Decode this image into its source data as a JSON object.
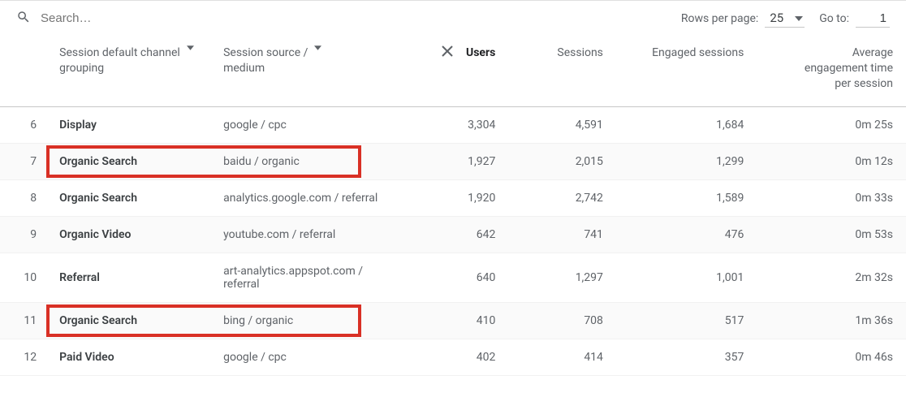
{
  "search": {
    "placeholder": "Search…"
  },
  "pager": {
    "rowsLabel": "Rows per page:",
    "rowsValue": "25",
    "gotoLabel": "Go to:",
    "gotoValue": "1"
  },
  "headers": {
    "channel": "Session default channel grouping",
    "source": "Session source / medium",
    "users": "Users",
    "sessions": "Sessions",
    "engaged": "Engaged sessions",
    "avg": "Average engagement time per session"
  },
  "rows": [
    {
      "idx": "6",
      "channel": "Display",
      "source": "google / cpc",
      "users": "3,304",
      "sessions": "4,591",
      "engaged": "1,684",
      "avg": "0m 25s",
      "highlight": false
    },
    {
      "idx": "7",
      "channel": "Organic Search",
      "source": "baidu / organic",
      "users": "1,927",
      "sessions": "2,015",
      "engaged": "1,299",
      "avg": "0m 12s",
      "highlight": true
    },
    {
      "idx": "8",
      "channel": "Organic Search",
      "source": "analytics.google.com / referral",
      "users": "1,920",
      "sessions": "2,742",
      "engaged": "1,589",
      "avg": "0m 33s",
      "highlight": false
    },
    {
      "idx": "9",
      "channel": "Organic Video",
      "source": "youtube.com / referral",
      "users": "642",
      "sessions": "741",
      "engaged": "476",
      "avg": "0m 53s",
      "highlight": false
    },
    {
      "idx": "10",
      "channel": "Referral",
      "source": "art-analytics.appspot.com / referral",
      "users": "640",
      "sessions": "1,297",
      "engaged": "1,001",
      "avg": "2m 32s",
      "highlight": false
    },
    {
      "idx": "11",
      "channel": "Organic Search",
      "source": "bing / organic",
      "users": "410",
      "sessions": "708",
      "engaged": "517",
      "avg": "1m 36s",
      "highlight": true
    },
    {
      "idx": "12",
      "channel": "Paid Video",
      "source": "google / cpc",
      "users": "402",
      "sessions": "414",
      "engaged": "357",
      "avg": "0m 46s",
      "highlight": false
    }
  ],
  "highlightedIndexes": [
    1,
    5
  ]
}
